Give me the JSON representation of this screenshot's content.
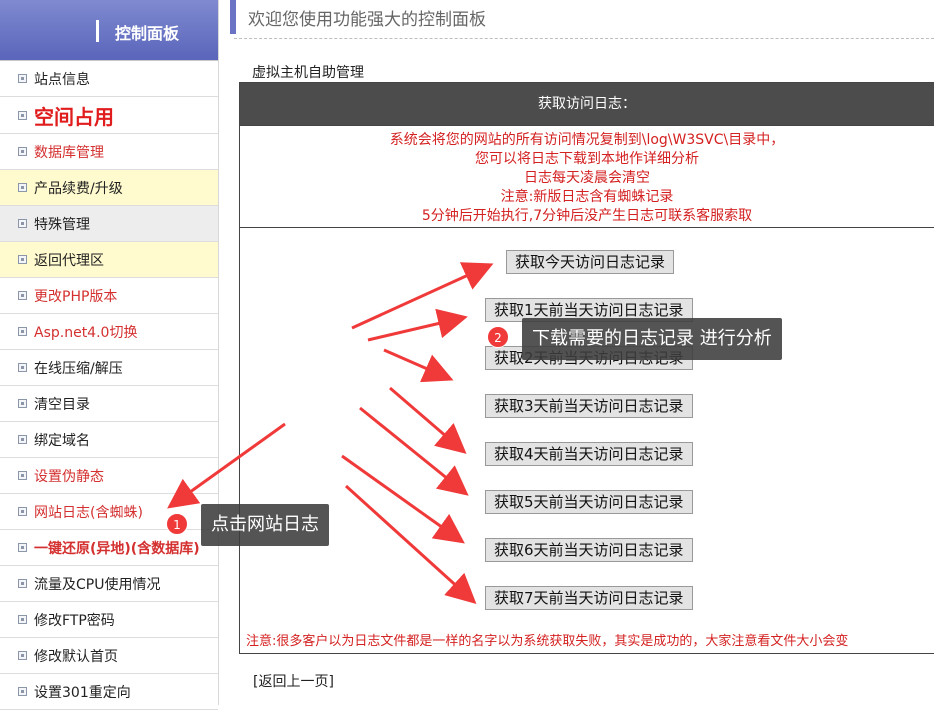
{
  "sidebar": {
    "header_title": "控制面板",
    "items": [
      {
        "label": "站点信息",
        "style": "normal"
      },
      {
        "label": "空间占用",
        "style": "big"
      },
      {
        "label": "数据库管理",
        "style": "red"
      },
      {
        "label": "产品续费/升级",
        "style": "yellow"
      },
      {
        "label": "特殊管理",
        "style": "grey"
      },
      {
        "label": "返回代理区",
        "style": "yellow"
      },
      {
        "label": "更改PHP版本",
        "style": "red"
      },
      {
        "label": "Asp.net4.0切换",
        "style": "red"
      },
      {
        "label": "在线压缩/解压",
        "style": "normal"
      },
      {
        "label": "清空目录",
        "style": "normal"
      },
      {
        "label": "绑定域名",
        "style": "normal"
      },
      {
        "label": "设置伪静态",
        "style": "red"
      },
      {
        "label": "网站日志(含蜘蛛)",
        "style": "red"
      },
      {
        "label": "一键还原(异地)(含数据库)",
        "style": "bold-red"
      },
      {
        "label": "流量及CPU使用情况",
        "style": "normal"
      },
      {
        "label": "修改FTP密码",
        "style": "normal"
      },
      {
        "label": "修改默认首页",
        "style": "normal"
      },
      {
        "label": "设置301重定向",
        "style": "normal"
      }
    ]
  },
  "main": {
    "welcome_title": "欢迎您使用功能强大的控制面板",
    "section_title": "虚拟主机自助管理",
    "panel_header": "获取访问日志：",
    "notices": [
      "系统会将您的网站的所有访问情况复制到\\log\\W3SVC\\目录中，",
      "您可以将日志下载到本地作详细分析",
      "日志每天凌晨会清空",
      "注意:新版日志含有蜘蛛记录",
      "5分钟后开始执行,7分钟后没产生日志可联系客服索取"
    ],
    "buttons": [
      "获取今天访问日志记录",
      "获取1天前当天访问日志记录",
      "获取2天前当天访问日志记录",
      "获取3天前当天访问日志记录",
      "获取4天前当天访问日志记录",
      "获取5天前当天访问日志记录",
      "获取6天前当天访问日志记录",
      "获取7天前当天访问日志记录"
    ],
    "footer_note": "注意:很多客户以为日志文件都是一样的名字以为系统获取失败，其实是成功的，大家注意看文件大小会变",
    "back_link": "[返回上一页]"
  },
  "annotations": {
    "step1_number": "1",
    "step1_text": "点击网站日志",
    "step2_number": "2",
    "step2_text": "下载需要的日志记录 进行分析",
    "arrow_color": "#f03a3a"
  }
}
